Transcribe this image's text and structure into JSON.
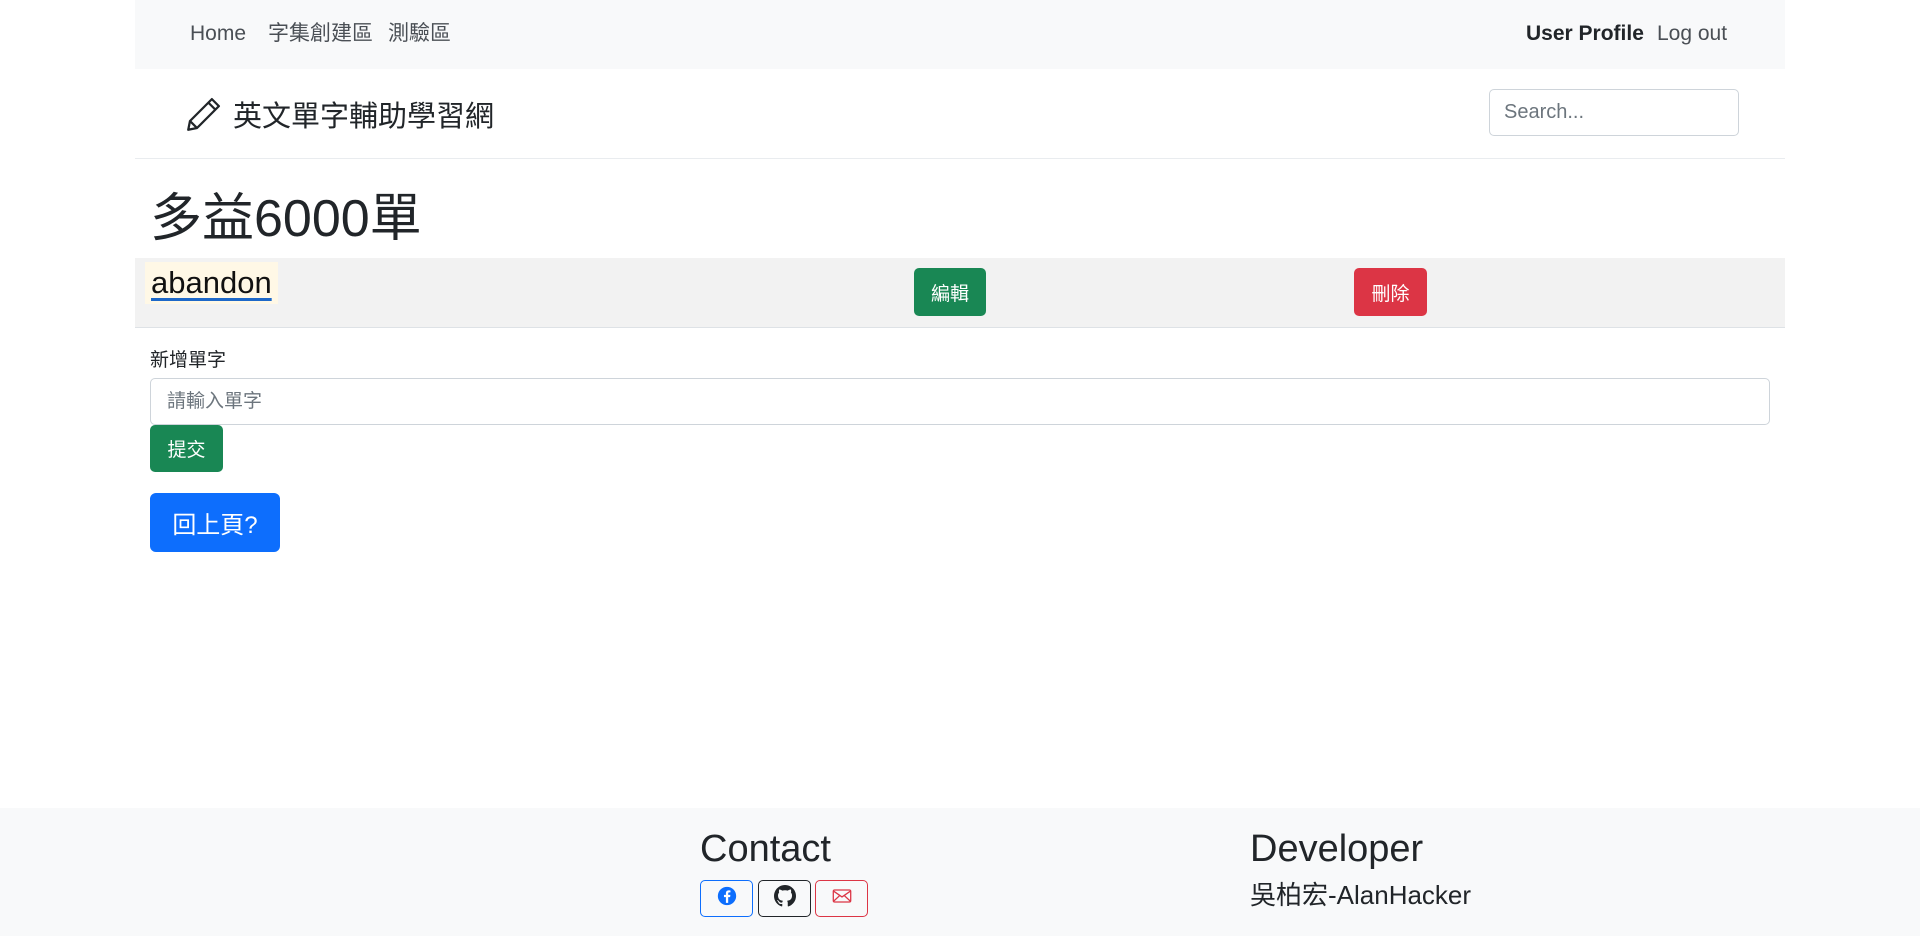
{
  "nav": {
    "home": "Home",
    "create": "字集創建區",
    "quiz": "測驗區",
    "profile": "User Profile",
    "logout": "Log out"
  },
  "brand": {
    "icon": "pencil-icon",
    "title": "英文單字輔助學習網"
  },
  "search": {
    "placeholder": "Search..."
  },
  "page": {
    "title": "多益6000單"
  },
  "words": [
    {
      "word": "abandon",
      "edit_label": "編輯",
      "delete_label": "刪除"
    }
  ],
  "add_form": {
    "label": "新增單字",
    "placeholder": "請輸入單字",
    "submit_label": "提交"
  },
  "back_button": "回上頁?",
  "footer": {
    "contact_heading": "Contact",
    "icons": [
      "facebook-icon",
      "github-icon",
      "envelope-icon"
    ],
    "developer_heading": "Developer",
    "developer_name": "吳柏宏-AlanHacker"
  },
  "colors": {
    "success": "#198754",
    "danger": "#dc3545",
    "primary": "#0d6efd",
    "nav_bg": "#f8f9fa",
    "row_bg": "#f2f2f2"
  }
}
